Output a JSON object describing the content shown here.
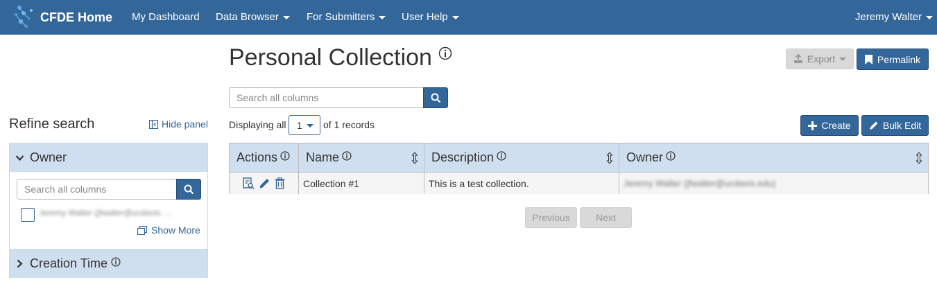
{
  "navbar": {
    "brand": "CFDE Home",
    "items": [
      {
        "label": "My Dashboard",
        "dropdown": false
      },
      {
        "label": "Data Browser",
        "dropdown": true
      },
      {
        "label": "For Submitters",
        "dropdown": true
      },
      {
        "label": "User Help",
        "dropdown": true
      }
    ],
    "user": "Jeremy Walter"
  },
  "page": {
    "title": "Personal Collection",
    "export_label": "Export",
    "permalink_label": "Permalink"
  },
  "search": {
    "placeholder": "Search all columns"
  },
  "sidebar": {
    "title": "Refine search",
    "hide_panel_label": "Hide panel",
    "facets": [
      {
        "label": "Owner",
        "expanded": true,
        "search_placeholder": "Search all columns",
        "values": [
          "Jeremy Walter (jfwalter@ucdavis. ..."
        ],
        "show_more_label": "Show More"
      },
      {
        "label": "Creation Time",
        "expanded": false
      }
    ]
  },
  "records": {
    "displaying_label": "Displaying all",
    "page_size": "1",
    "count_label": "of 1 records",
    "create_label": "Create",
    "bulk_edit_label": "Bulk Edit"
  },
  "table": {
    "columns": [
      "Actions",
      "Name",
      "Description",
      "Owner"
    ],
    "rows": [
      {
        "name": "Collection #1",
        "description": "This is a test collection.",
        "owner": "Jeremy Walter (jfwalter@ucdavis.edu)"
      }
    ]
  },
  "pagination": {
    "previous_label": "Previous",
    "next_label": "Next"
  },
  "colors": {
    "navbar": "#336699",
    "header_bg": "#d0dfef",
    "disabled_button": "#d9d9d9"
  }
}
